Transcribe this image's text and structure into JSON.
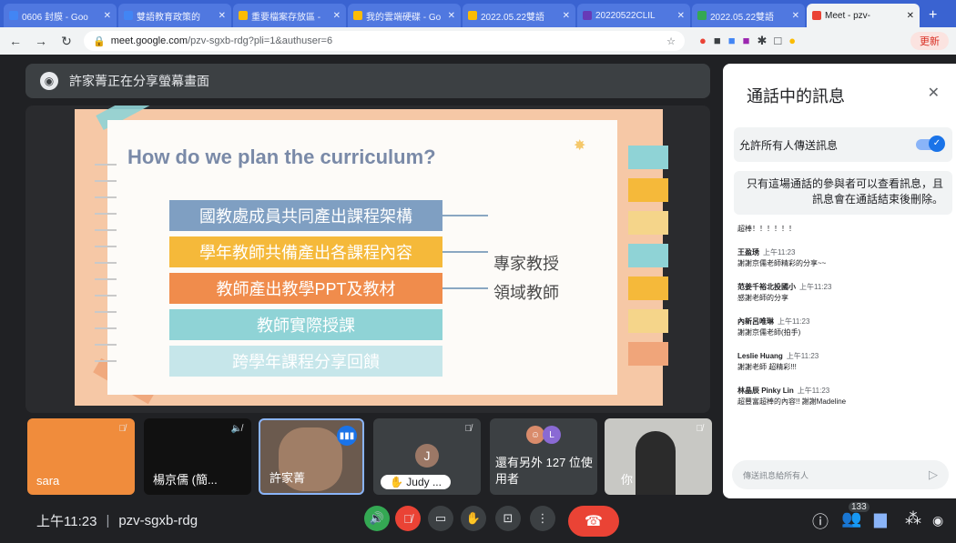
{
  "browser": {
    "tabs": [
      {
        "label": "0606 封膜 - Goo",
        "color": "#4285f4"
      },
      {
        "label": "雙語教育政策的",
        "color": "#4285f4"
      },
      {
        "label": "重要檔案存放區 -",
        "color": "#fbbc04"
      },
      {
        "label": "我的雲端硬碟 - Go",
        "color": "#fbbc04"
      },
      {
        "label": "2022.05.22雙語",
        "color": "#fbbc04"
      },
      {
        "label": "20220522CLIL",
        "color": "#673ab7"
      },
      {
        "label": "2022.05.22雙語",
        "color": "#34a853"
      },
      {
        "label": "Meet - pzv-",
        "color": "#ea4335"
      }
    ],
    "new_tab": "+",
    "url_host": "meet.google.com",
    "url_path": "/pzv-sgxb-rdg?pli=1&authuser=6",
    "update_label": "更新"
  },
  "presenter": {
    "label": "許家菁正在分享螢幕畫面"
  },
  "slide": {
    "title": "How do we plan the curriculum?",
    "steps": [
      {
        "text": "國教處成員共同產出課程架構",
        "color": "#7f9fc2"
      },
      {
        "text": "學年教師共備產出各課程內容",
        "color": "#f5b93a"
      },
      {
        "text": "教師產出教學PPT及教材",
        "color": "#f08c4c"
      },
      {
        "text": "教師實際授課",
        "color": "#8fd3d6"
      },
      {
        "text": "跨學年課程分享回饋",
        "color": "#c6e6ea"
      }
    ],
    "side_labels": [
      "專家教授",
      "領域教師"
    ]
  },
  "chat": {
    "title": "通話中的訊息",
    "allow_label": "允許所有人傳送訊息",
    "notice": "只有這場通話的參與者可以查看訊息，且訊息會在通話結束後刪除。",
    "messages": [
      {
        "who": "",
        "time": "",
        "text": "超棒！！！！！！"
      },
      {
        "who": "王盈琇",
        "time": "上午11:23",
        "text": "謝謝京儒老師精彩的分享~~"
      },
      {
        "who": "范姜千裕北投國小",
        "time": "上午11:23",
        "text": "感謝老師的分享"
      },
      {
        "who": "內新呂唯琳",
        "time": "上午11:23",
        "text": "謝謝京儒老師(拍手)"
      },
      {
        "who": "Leslie Huang",
        "time": "上午11:23",
        "text": "謝謝老師 超精彩!!!"
      },
      {
        "who": "林晶辰 Pinky Lin",
        "time": "上午11:23",
        "text": "超豐富超棒的內容!! 謝謝Madeline"
      }
    ],
    "input_placeholder": "傳送訊息給所有人"
  },
  "participants": [
    {
      "name": "sara"
    },
    {
      "name": "楊京儒 (簡..."
    },
    {
      "name": "許家菁"
    },
    {
      "name": "Judy ...",
      "initial": "J"
    },
    {
      "name": "還有另外 127 位使用者",
      "initial": "L"
    },
    {
      "name": "你"
    }
  ],
  "meeting": {
    "time": "上午11:23",
    "code": "pzv-sgxb-rdg",
    "people_count": "133"
  },
  "colors": {
    "accent": "#1a73e8",
    "hangup": "#ea4335",
    "sara_tile": "#f08c3c"
  }
}
